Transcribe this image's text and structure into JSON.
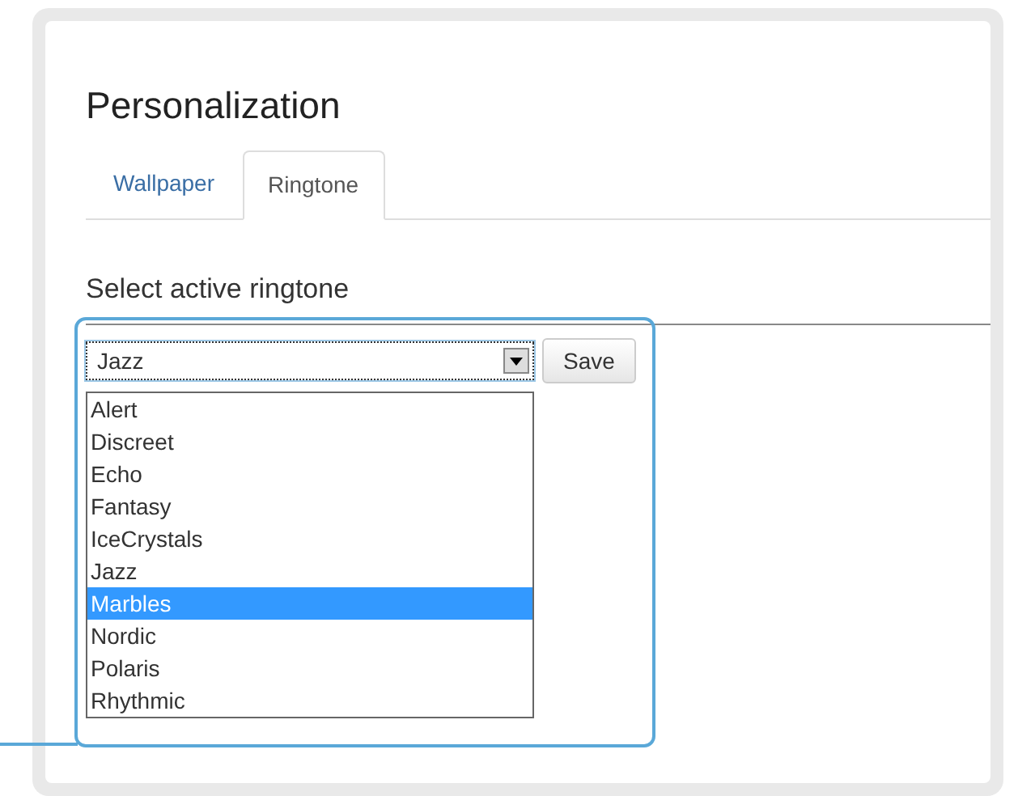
{
  "title": "Personalization",
  "tabs": [
    {
      "label": "Wallpaper",
      "selected": false
    },
    {
      "label": "Ringtone",
      "selected": true
    }
  ],
  "section_heading": "Select active ringtone",
  "ringtone_select": {
    "value": "Jazz",
    "expanded": true,
    "options": [
      {
        "label": "Alert",
        "highlighted": false
      },
      {
        "label": "Discreet",
        "highlighted": false
      },
      {
        "label": "Echo",
        "highlighted": false
      },
      {
        "label": "Fantasy",
        "highlighted": false
      },
      {
        "label": "IceCrystals",
        "highlighted": false
      },
      {
        "label": "Jazz",
        "highlighted": false
      },
      {
        "label": "Marbles",
        "highlighted": true
      },
      {
        "label": "Nordic",
        "highlighted": false
      },
      {
        "label": "Polaris",
        "highlighted": false
      },
      {
        "label": "Rhythmic",
        "highlighted": false
      }
    ]
  },
  "save_button": "Save"
}
